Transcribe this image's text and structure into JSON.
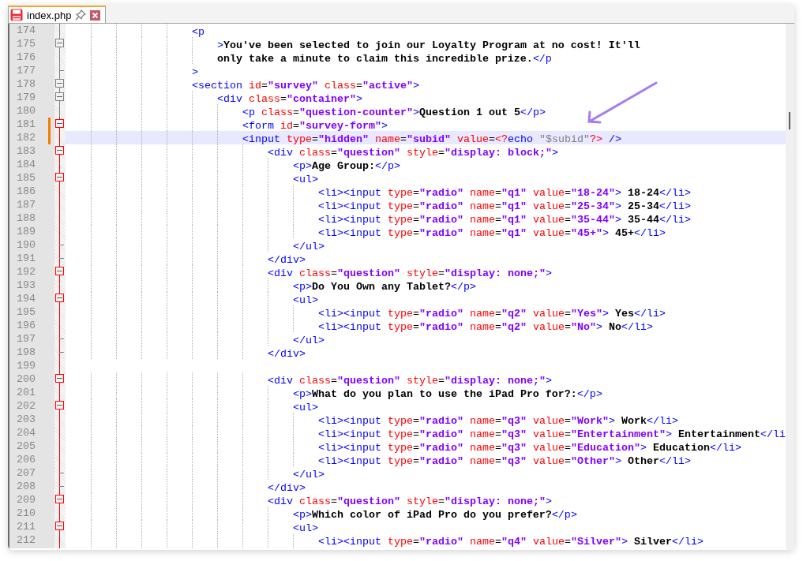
{
  "tab": {
    "title": "index.php",
    "selected": true
  },
  "lines": [
    {
      "number": "174",
      "text": "                    <p",
      "kind": "line",
      "block": false,
      "changed": false,
      "current": false
    },
    {
      "number": "175",
      "text": "                        >You've been selected to join our Loyalty Program at no cost! It'll",
      "kind": "open",
      "block": false,
      "changed": false,
      "current": false
    },
    {
      "number": "176",
      "text": "                        only take a minute to claim this incredible prize.</p",
      "kind": "line",
      "block": false,
      "changed": false,
      "current": false
    },
    {
      "number": "177",
      "text": "                    >",
      "kind": "end",
      "block": false,
      "changed": false,
      "current": false
    },
    {
      "number": "178",
      "text": "                    <section id=\"survey\" class=\"active\">",
      "kind": "open",
      "block": false,
      "changed": false,
      "current": false
    },
    {
      "number": "179",
      "text": "                        <div class=\"container\">",
      "kind": "open",
      "block": false,
      "changed": false,
      "current": false
    },
    {
      "number": "180",
      "text": "                            <p class=\"question-counter\">Question 1 out 5</p>",
      "kind": "line",
      "block": false,
      "changed": false,
      "current": false
    },
    {
      "number": "181",
      "text": "                            <form id=\"survey-form\">",
      "kind": "open",
      "block": true,
      "changed": true,
      "current": false
    },
    {
      "number": "182",
      "text": "                            <input type=\"hidden\" name=\"subid\" value=<?echo \"$subid\"?> />",
      "kind": "line",
      "block": true,
      "changed": true,
      "current": true
    },
    {
      "number": "183",
      "text": "                                <div class=\"question\" style=\"display: block;\">",
      "kind": "open",
      "block": true,
      "changed": false,
      "current": false
    },
    {
      "number": "184",
      "text": "                                    <p>Age Group:</p>",
      "kind": "line",
      "block": true,
      "changed": false,
      "current": false
    },
    {
      "number": "185",
      "text": "                                    <ul>",
      "kind": "open",
      "block": true,
      "changed": false,
      "current": false
    },
    {
      "number": "186",
      "text": "                                        <li><input type=\"radio\" name=\"q1\" value=\"18-24\"> 18-24</li>",
      "kind": "line",
      "block": true,
      "changed": false,
      "current": false
    },
    {
      "number": "187",
      "text": "                                        <li><input type=\"radio\" name=\"q1\" value=\"25-34\"> 25-34</li>",
      "kind": "line",
      "block": true,
      "changed": false,
      "current": false
    },
    {
      "number": "188",
      "text": "                                        <li><input type=\"radio\" name=\"q1\" value=\"35-44\"> 35-44</li>",
      "kind": "line",
      "block": true,
      "changed": false,
      "current": false
    },
    {
      "number": "189",
      "text": "                                        <li><input type=\"radio\" name=\"q1\" value=\"45+\"> 45+</li>",
      "kind": "line",
      "block": true,
      "changed": false,
      "current": false
    },
    {
      "number": "190",
      "text": "                                    </ul>",
      "kind": "end",
      "block": true,
      "changed": false,
      "current": false
    },
    {
      "number": "191",
      "text": "                                </div>",
      "kind": "end",
      "block": true,
      "changed": false,
      "current": false
    },
    {
      "number": "192",
      "text": "                                <div class=\"question\" style=\"display: none;\">",
      "kind": "open",
      "block": true,
      "changed": false,
      "current": false
    },
    {
      "number": "193",
      "text": "                                    <p>Do You Own any Tablet?</p>",
      "kind": "line",
      "block": true,
      "changed": false,
      "current": false
    },
    {
      "number": "194",
      "text": "                                    <ul>",
      "kind": "open",
      "block": true,
      "changed": false,
      "current": false
    },
    {
      "number": "195",
      "text": "                                        <li><input type=\"radio\" name=\"q2\" value=\"Yes\"> Yes</li>",
      "kind": "line",
      "block": true,
      "changed": false,
      "current": false
    },
    {
      "number": "196",
      "text": "                                        <li><input type=\"radio\" name=\"q2\" value=\"No\"> No</li>",
      "kind": "line",
      "block": true,
      "changed": false,
      "current": false
    },
    {
      "number": "197",
      "text": "                                    </ul>",
      "kind": "end",
      "block": true,
      "changed": false,
      "current": false
    },
    {
      "number": "198",
      "text": "                                </div>",
      "kind": "end",
      "block": true,
      "changed": false,
      "current": false
    },
    {
      "number": "199",
      "kind": "line",
      "block": true,
      "changed": false,
      "current": false
    },
    {
      "number": "200",
      "text": "                                <div class=\"question\" style=\"display: none;\">",
      "kind": "open",
      "block": true,
      "changed": false,
      "current": false
    },
    {
      "number": "201",
      "text": "                                    <p>What do you plan to use the iPad Pro for?:</p>",
      "kind": "line",
      "block": true,
      "changed": false,
      "current": false
    },
    {
      "number": "202",
      "text": "                                    <ul>",
      "kind": "open",
      "block": true,
      "changed": false,
      "current": false
    },
    {
      "number": "203",
      "text": "                                        <li><input type=\"radio\" name=\"q3\" value=\"Work\"> Work</li>",
      "kind": "line",
      "block": true,
      "changed": false,
      "current": false
    },
    {
      "number": "204",
      "text": "                                        <li><input type=\"radio\" name=\"q3\" value=\"Entertainment\"> Entertainment</li",
      "kind": "line",
      "block": true,
      "changed": false,
      "current": false
    },
    {
      "number": "205",
      "text": "                                        <li><input type=\"radio\" name=\"q3\" value=\"Education\"> Education</li>",
      "kind": "line",
      "block": true,
      "changed": false,
      "current": false
    },
    {
      "number": "206",
      "text": "                                        <li><input type=\"radio\" name=\"q3\" value=\"Other\"> Other</li>",
      "kind": "line",
      "block": true,
      "changed": false,
      "current": false
    },
    {
      "number": "207",
      "text": "                                    </ul>",
      "kind": "end",
      "block": true,
      "changed": false,
      "current": false
    },
    {
      "number": "208",
      "text": "                                </div>",
      "kind": "end",
      "block": true,
      "changed": false,
      "current": false
    },
    {
      "number": "209",
      "text": "                                <div class=\"question\" style=\"display: none;\">",
      "kind": "open",
      "block": true,
      "changed": false,
      "current": false
    },
    {
      "number": "210",
      "text": "                                    <p>Which color of iPad Pro do you prefer?</p>",
      "kind": "line",
      "block": true,
      "changed": false,
      "current": false
    },
    {
      "number": "211",
      "text": "                                    <ul>",
      "kind": "open",
      "block": true,
      "changed": false,
      "current": false
    },
    {
      "number": "212",
      "text": "                                        <li><input type=\"radio\" name=\"q4\" value=\"Silver\"> Silver</li>",
      "kind": "line",
      "block": true,
      "changed": false,
      "current": false
    }
  ]
}
